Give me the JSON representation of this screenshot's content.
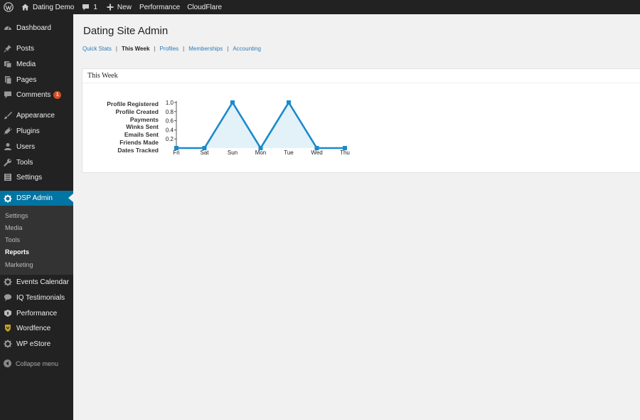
{
  "adminbar": {
    "site_name": "Dating Demo",
    "comments_count": "1",
    "new_label": "New",
    "performance_label": "Performance",
    "cloudflare_label": "CloudFlare"
  },
  "sidebar": {
    "items": [
      {
        "label": "Dashboard",
        "icon": "dashboard-icon"
      },
      {
        "label": "Posts",
        "icon": "pin-icon"
      },
      {
        "label": "Media",
        "icon": "media-icon"
      },
      {
        "label": "Pages",
        "icon": "pages-icon"
      },
      {
        "label": "Comments",
        "icon": "comment-icon",
        "badge": "1"
      },
      {
        "label": "Appearance",
        "icon": "paintbrush-icon"
      },
      {
        "label": "Plugins",
        "icon": "plugin-icon"
      },
      {
        "label": "Users",
        "icon": "user-icon"
      },
      {
        "label": "Tools",
        "icon": "wrench-icon"
      },
      {
        "label": "Settings",
        "icon": "settings-icon"
      },
      {
        "label": "DSP Admin",
        "icon": "gear-icon"
      },
      {
        "label": "Events Calendar",
        "icon": "gear-icon"
      },
      {
        "label": "IQ Testimonials",
        "icon": "speech-bubble-icon"
      },
      {
        "label": "Performance",
        "icon": "performance-icon"
      },
      {
        "label": "Wordfence",
        "icon": "wordfence-icon"
      },
      {
        "label": "WP eStore",
        "icon": "gear-icon"
      }
    ],
    "submenu": [
      "Settings",
      "Media",
      "Tools",
      "Reports",
      "Marketing"
    ],
    "collapse_label": "Collapse menu"
  },
  "colors": {
    "accent": "#0074a2",
    "link": "#2e7bb6",
    "series": "#1a8acb",
    "badge": "#d54e21"
  },
  "main": {
    "title": "Dating Site Admin",
    "subnav": [
      "Quick Stats",
      "This Week",
      "Profiles",
      "Memberships",
      "Accounting"
    ],
    "box_title": "This Week",
    "legend": [
      "Profile Registered",
      "Profile Created",
      "Payments",
      "Winks Sent",
      "Emails Sent",
      "Friends Made",
      "Dates Tracked"
    ]
  },
  "chart_data": {
    "type": "area",
    "categories": [
      "Fri",
      "Sat",
      "Sun",
      "Mon",
      "Tue",
      "Wed",
      "Thu"
    ],
    "values": [
      0,
      0,
      1.0,
      0,
      1.0,
      0,
      0
    ],
    "y_ticks": [
      "1.0",
      "0.8",
      "0.6",
      "0.4",
      "0.2"
    ],
    "ylim": [
      0,
      1.0
    ],
    "legend_entries": [
      "Profile Registered",
      "Profile Created",
      "Payments",
      "Winks Sent",
      "Emails Sent",
      "Friends Made",
      "Dates Tracked"
    ],
    "legend_position": "left",
    "grid": false
  }
}
